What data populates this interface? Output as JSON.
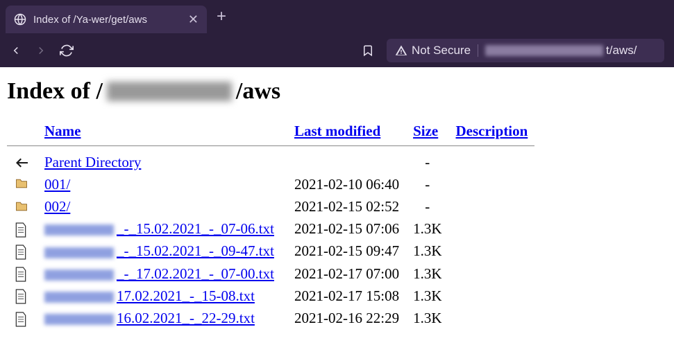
{
  "browser": {
    "tab_title": "Index of /Ya-wer/get/aws",
    "not_secure_label": "Not Secure",
    "url_suffix": "t/aws/"
  },
  "page": {
    "heading_prefix": "Index of /",
    "heading_suffix": "/aws"
  },
  "headers": {
    "name": "Name",
    "modified": "Last modified",
    "size": "Size",
    "description": "Description"
  },
  "rows": [
    {
      "type": "parent",
      "name": "Parent Directory",
      "modified": "",
      "size": "-"
    },
    {
      "type": "dir",
      "name": "001/",
      "modified": "2021-02-10 06:40",
      "size": "-"
    },
    {
      "type": "dir",
      "name": "002/",
      "modified": "2021-02-15 02:52",
      "size": "-"
    },
    {
      "type": "file",
      "name_suffix": "_-_15.02.2021_-_07-06.txt",
      "modified": "2021-02-15 07:06",
      "size": "1.3K"
    },
    {
      "type": "file",
      "name_suffix": "_-_15.02.2021_-_09-47.txt",
      "modified": "2021-02-15 09:47",
      "size": "1.3K"
    },
    {
      "type": "file",
      "name_suffix": "_-_17.02.2021_-_07-00.txt",
      "modified": "2021-02-17 07:00",
      "size": "1.3K"
    },
    {
      "type": "file",
      "name_suffix": "17.02.2021_-_15-08.txt",
      "modified": "2021-02-17 15:08",
      "size": "1.3K"
    },
    {
      "type": "file",
      "name_suffix": "16.02.2021_-_22-29.txt",
      "modified": "2021-02-16 22:29",
      "size": "1.3K"
    }
  ]
}
